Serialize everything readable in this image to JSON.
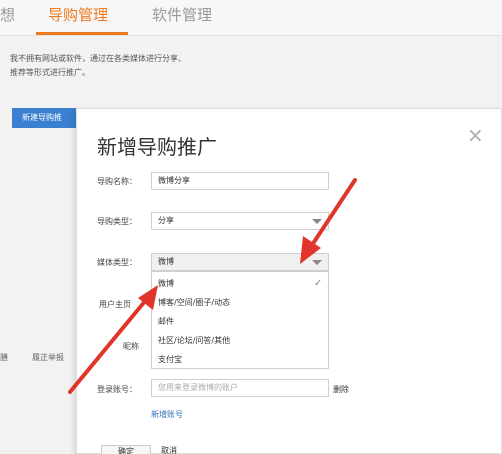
{
  "background": {
    "tabs": {
      "partial": "想",
      "active": "导购管理",
      "inactive": "软件管理"
    },
    "description": "我不拥有网站或软件，通过在各类媒体进行分享、推荐等形式进行推广。",
    "new_button": "新建导购推",
    "report_a": "膳",
    "report_b": "履正举报"
  },
  "modal": {
    "title": "新增导购推广",
    "close": "×",
    "fields": {
      "name_label": "导购名称：",
      "name_value": "微博分享",
      "type_label": "导购类型：",
      "type_value": "分享",
      "media_label": "媒体类型：",
      "media_value": "微博",
      "homepage_label": "用户主页",
      "nickname_label": "昵称",
      "login_label": "登录账号：",
      "login_placeholder": "您用来登录微博的账户",
      "delete_link": "删除",
      "add_account_link": "新增账号"
    },
    "dropdown_options": [
      "微博",
      "博客/空间/圈子/动态",
      "邮件",
      "社区/论坛/问答/其他",
      "支付宝"
    ],
    "selected_check": "✓",
    "footer": {
      "confirm": "确定",
      "cancel": "取消"
    }
  },
  "colors": {
    "accent": "#f07a1e",
    "link": "#2f6fb8",
    "button": "#3a7fd0",
    "arrow": "#e0352b"
  }
}
